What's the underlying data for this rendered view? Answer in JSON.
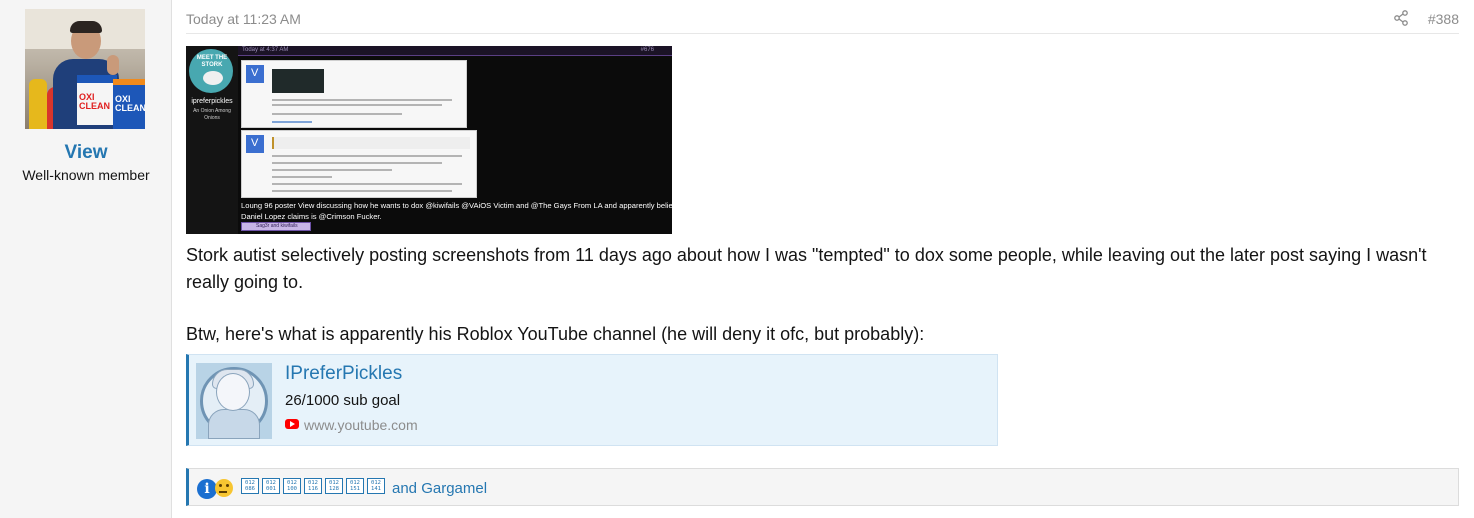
{
  "user": {
    "name": "View",
    "title": "Well-known member",
    "avatar_text_1": "OXI CLEAN",
    "avatar_text_2": "OXI CLEAN"
  },
  "post": {
    "date": "Today at 11:23 AM",
    "number": "#388",
    "share_icon": "share-icon",
    "attachment": {
      "topbar_date": "Today at 4:37 AM",
      "topbar_num": "#676",
      "stork_label": "MEET THE STORK",
      "sidebar_name": "iprefer​pickles",
      "sidebar_title": "An Onion Among Onions",
      "caption": "Loung 96 poster View discussing how he wants to dox @kiwifails @VAiOS Victim and @The Gays From LA and apparently believes the dox",
      "caption2": "Daniel Lopez claims is @Crimson Fucker.",
      "react_text": "Sag3r and kiwifails"
    },
    "paragraph1": "Stork autist selectively posting screenshots from 11 days ago about how I was \"tempted\" to dox some people, while leaving out the later post saying I wasn't really going to.",
    "paragraph2": "Btw, here's what is apparently his Roblox YouTube channel (he will deny it ofc, but probably):",
    "embed": {
      "title": "IPreferPickles",
      "description": "26/1000 sub goal",
      "domain": "www.youtube.com",
      "site_icon": "youtube-icon"
    },
    "reactions": {
      "icons": [
        "informative-icon",
        "thinking-icon"
      ],
      "codes": [
        "012\n086",
        "012\n001",
        "012\n100",
        "012\n116",
        "012\n128",
        "012\n151",
        "012\n141"
      ],
      "trailing_text": "and Gargamel"
    }
  }
}
